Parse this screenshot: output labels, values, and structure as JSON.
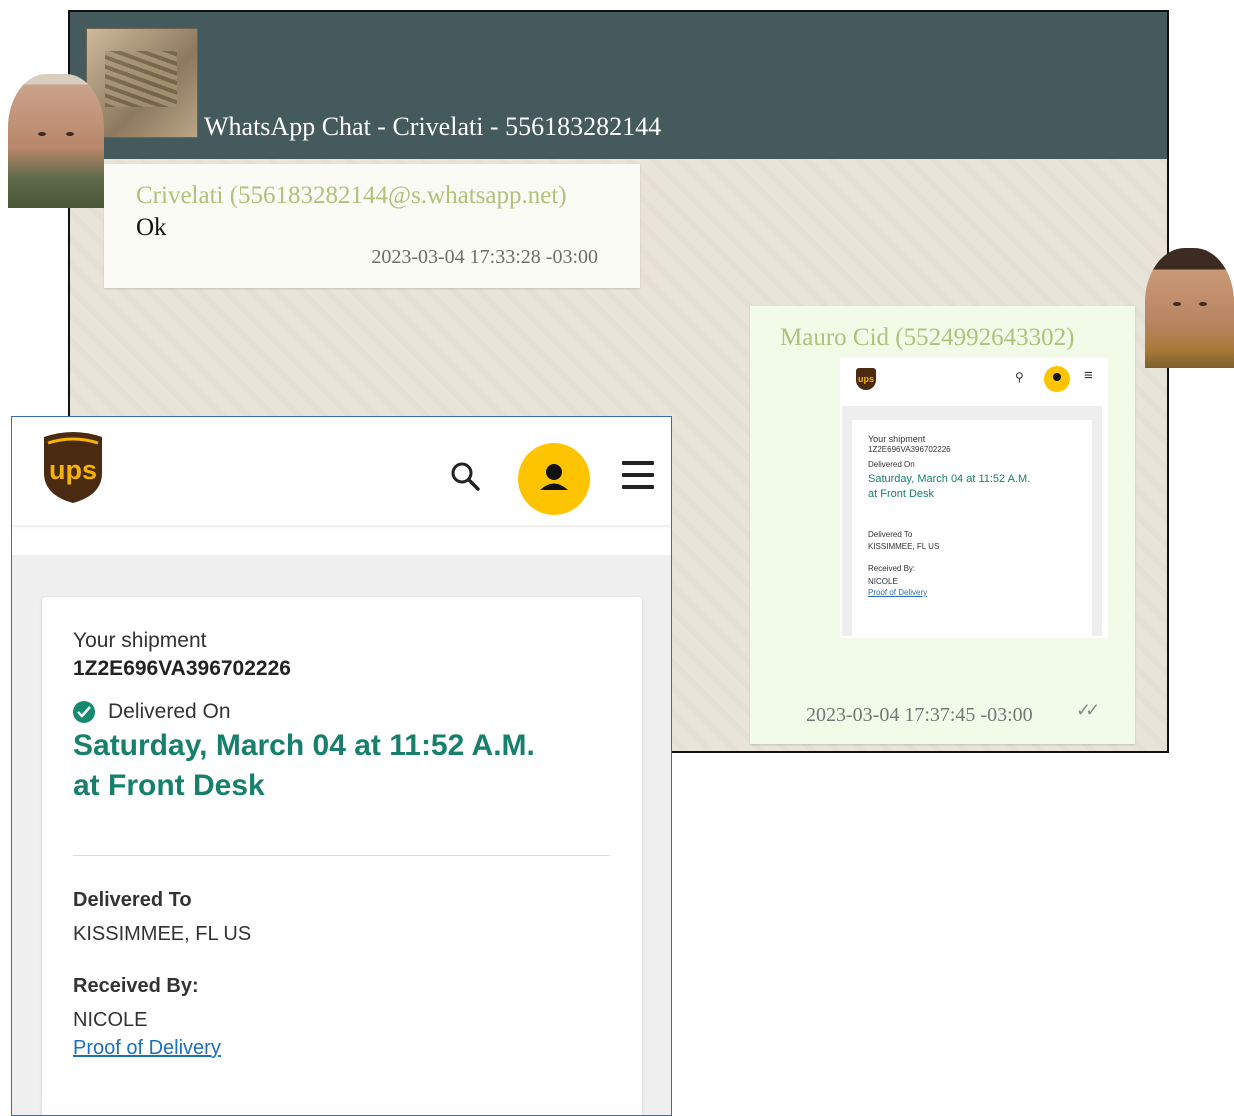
{
  "whatsapp": {
    "title": "WhatsApp Chat - Crivelati - 556183282144",
    "messages": [
      {
        "sender": "Crivelati (556183282144@s.whatsapp.net)",
        "text": "Ok",
        "timestamp": "2023-03-04 17:33:28 -03:00"
      },
      {
        "sender": "Mauro Cid (5524992643302)",
        "timestamp": "2023-03-04 17:37:45 -03:00",
        "ticks": "✓✓"
      }
    ],
    "colors": {
      "header": "#455a5c",
      "sender": "#aec27b",
      "incoming_bubble": "#fbfbf5",
      "outgoing_bubble": "#f2fbe8"
    }
  },
  "ups": {
    "logo_text": "ups",
    "icons": [
      "search-icon",
      "account-icon",
      "menu-icon"
    ],
    "shipment_label": "Your shipment",
    "tracking_number": "1Z2E696VA396702226",
    "status_label": "Delivered On",
    "delivery_line1": "Saturday, March 04 at 11:52 A.M.",
    "delivery_line2": "at Front Desk",
    "delivered_to_label": "Delivered To",
    "delivered_to_value": "KISSIMMEE, FL US",
    "received_by_label": "Received By:",
    "received_by_value": "NICOLE",
    "proof_link": "Proof of Delivery",
    "colors": {
      "accent_green": "#16806d",
      "avatar_yellow": "#ffc400",
      "link_blue": "#1d6fc2",
      "brand_brown": "#4b2a12"
    }
  },
  "mini_ups": {
    "shipment_label": "Your shipment",
    "tracking_number": "1Z2E696VA396702226",
    "status_label": "Delivered On",
    "delivery_line1": "Saturday, March 04 at 11:52 A.M.",
    "delivery_line2": "at Front Desk",
    "delivered_to_label": "Delivered To",
    "delivered_to_value": "KISSIMMEE, FL US",
    "received_by_label": "Received By:",
    "received_by_value": "NICOLE",
    "proof_link": "Proof of Delivery"
  }
}
